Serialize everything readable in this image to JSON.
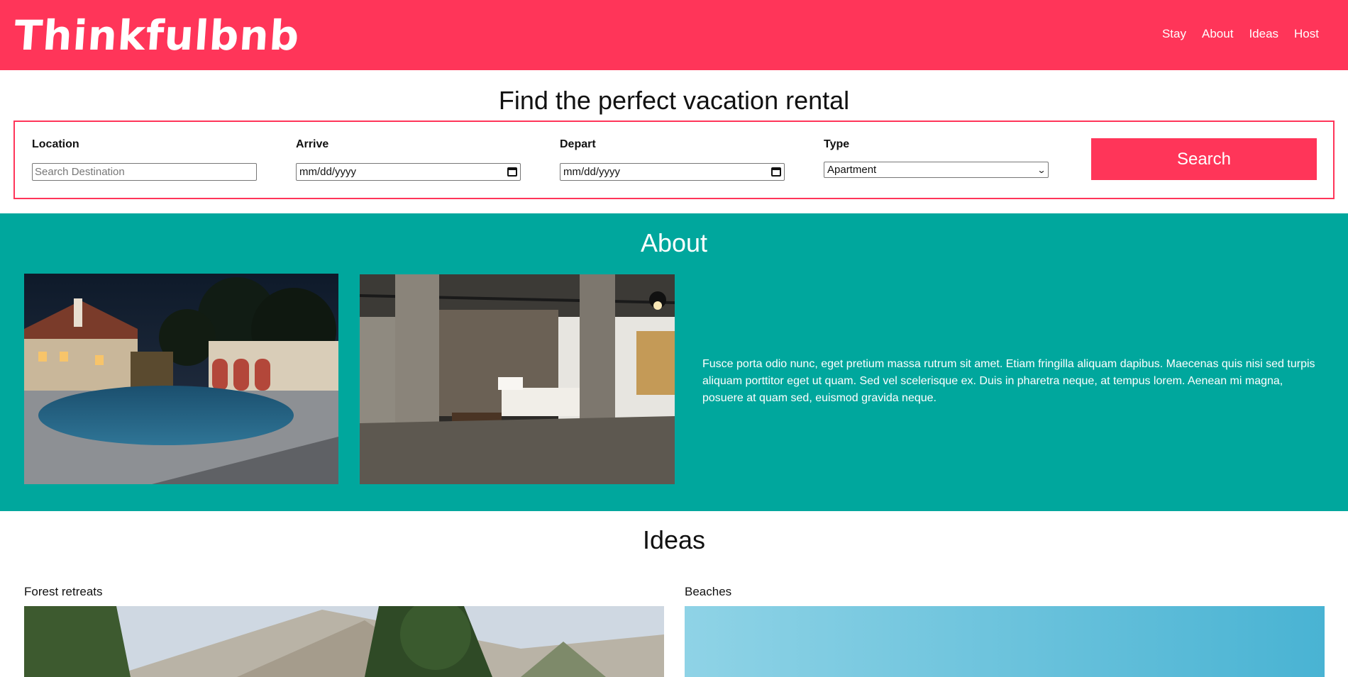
{
  "header": {
    "logo": "Thinkfulbnb",
    "nav": [
      "Stay",
      "About",
      "Ideas",
      "Host"
    ]
  },
  "search": {
    "title": "Find the perfect vacation rental",
    "location_label": "Location",
    "location_placeholder": "Search Destination",
    "arrive_label": "Arrive",
    "arrive_value": "mm/dd/yyyy",
    "depart_label": "Depart",
    "depart_value": "mm/dd/yyyy",
    "type_label": "Type",
    "type_value": "Apartment",
    "button": "Search"
  },
  "about": {
    "title": "About",
    "text": "Fusce porta odio nunc, eget pretium massa rutrum sit amet. Etiam fringilla aliquam dapibus. Maecenas quis nisi sed turpis aliquam porttitor eget ut quam. Sed vel scelerisque ex. Duis in pharetra neque, at tempus lorem. Aenean mi magna, posuere at quam sed, euismod gravida neque."
  },
  "ideas": {
    "title": "Ideas",
    "items": [
      "Forest retreats",
      "Beaches"
    ]
  },
  "colors": {
    "brand": "#ff3559",
    "teal": "#00a79d"
  }
}
